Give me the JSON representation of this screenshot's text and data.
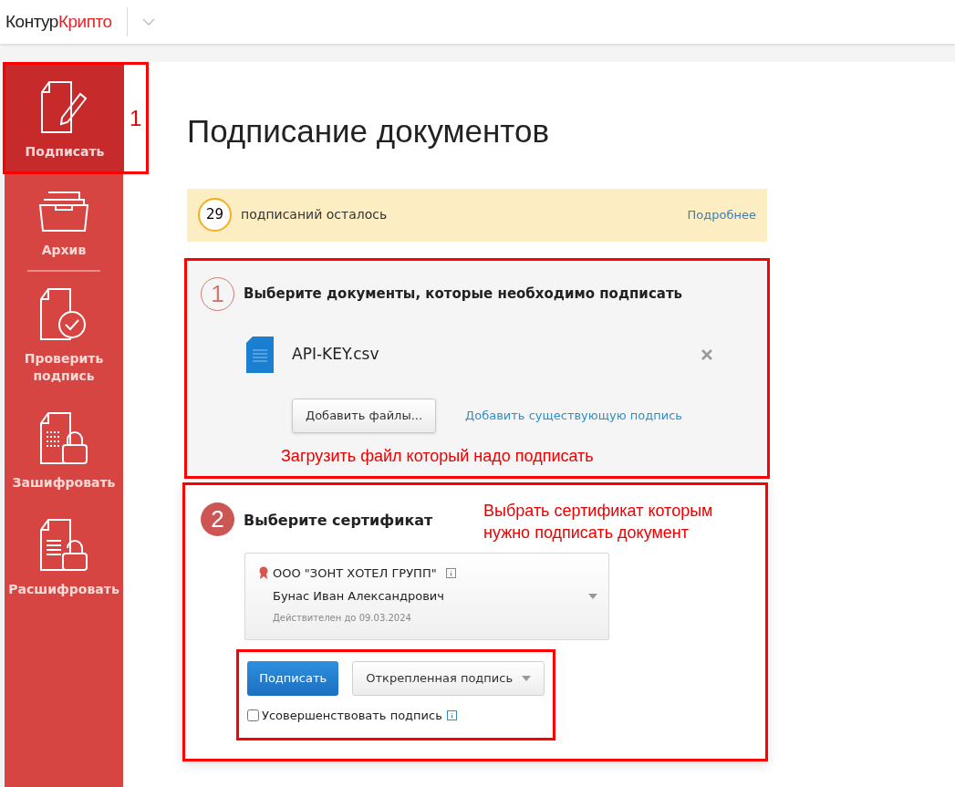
{
  "header": {
    "logo_dark": "Контур",
    "logo_red": "Крипто"
  },
  "sidebar": {
    "items": [
      {
        "label": "Подписать",
        "kind": "sign",
        "selected": true,
        "annotation": "1"
      },
      {
        "label": "Архив",
        "kind": "archive",
        "selected": false
      },
      {
        "label": "Проверить подпись",
        "kind": "verify",
        "selected": false
      },
      {
        "label": "Зашифровать",
        "kind": "encrypt",
        "selected": false
      },
      {
        "label": "Расшифровать",
        "kind": "decrypt",
        "selected": false
      }
    ]
  },
  "page_title": "Подписание документов",
  "quota": {
    "count": "29",
    "text": "подписаний осталось",
    "link": "Подробнее"
  },
  "step1": {
    "number": "1",
    "title": "Выберите документы, которые необходимо подписать",
    "files": [
      {
        "name": "API-KEY.csv"
      }
    ],
    "add_button": "Добавить файлы...",
    "add_link": "Добавить существующую подпись",
    "annotation": "Загрузить файл который надо подписать"
  },
  "step2": {
    "number": "2",
    "title": "Выберите сертификат",
    "annotation": "Выбрать сертификат которым нужно подписать документ",
    "certificate": {
      "organization": "ООО \"ЗОНТ ХОТЕЛ ГРУПП\"",
      "owner": "Бунас Иван Александрович",
      "validity": "Действителен до 09.03.2024"
    },
    "sign_button": "Подписать",
    "signature_type": "Открепленная подпись",
    "enhance": {
      "label": "Усовершенствовать подпись",
      "checked": false
    }
  }
}
